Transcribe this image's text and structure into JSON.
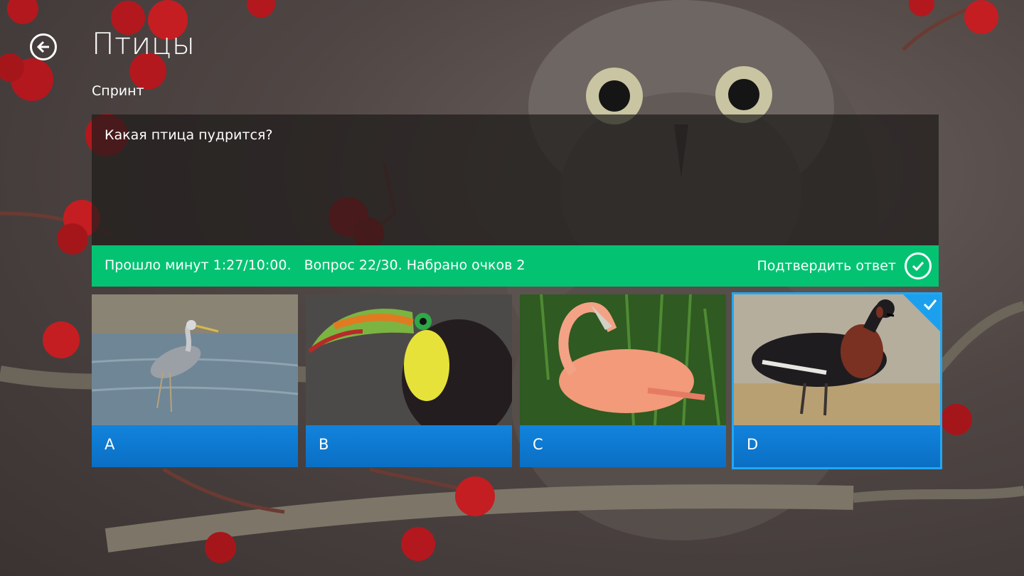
{
  "header": {
    "title": "Птицы",
    "subtitle": "Спринт"
  },
  "question": {
    "text": "Какая птица пудрится?"
  },
  "status": {
    "text": "Прошло минут 1:27/10:00.   Вопрос 22/30. Набрано очков 2",
    "confirm_label": "Подтвердить ответ"
  },
  "answers": [
    {
      "letter": "A",
      "bird": "grey-heron",
      "selected": false
    },
    {
      "letter": "B",
      "bird": "toucan",
      "selected": false
    },
    {
      "letter": "C",
      "bird": "flamingo",
      "selected": false
    },
    {
      "letter": "D",
      "bird": "red-breasted-goose",
      "selected": true
    }
  ],
  "icons": {
    "back": "back-arrow-icon",
    "confirm": "checkmark-circle-icon",
    "selected": "checkmark-icon"
  },
  "colors": {
    "status_bar": "#03c373",
    "tile_label": "#0b73c9",
    "selection": "#21a7f3"
  }
}
